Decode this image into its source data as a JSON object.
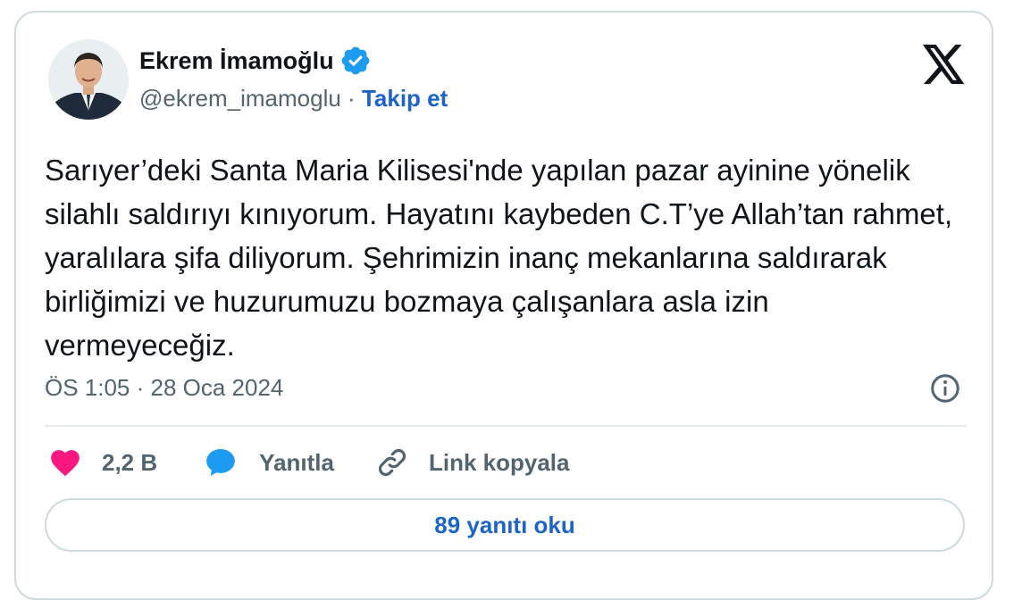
{
  "author": {
    "name": "Ekrem İmamoğlu",
    "handle": "@ekrem_imamoglu",
    "separator": "·",
    "follow_label": "Takip et",
    "verified": true
  },
  "tweet": {
    "text": "Sarıyer’deki Santa Maria Kilisesi'nde yapılan pazar ayinine yönelik silahlı saldırıyı kınıyorum. Hayatını kaybeden C.T’ye Allah’tan rahmet, yaralılara şifa diliyorum. Şehrimizin inanç mekanlarına saldırarak birliğimizi ve huzurumuzu bozmaya çalışanlara asla izin vermeyeceğiz.",
    "timestamp": "ÖS 1:05 · 28 Oca 2024"
  },
  "actions": {
    "like_count": "2,2 B",
    "reply_label": "Yanıtla",
    "copy_link_label": "Link kopyala"
  },
  "read_replies_label": "89 yanıtı oku",
  "icons": {
    "avatar": "avatar",
    "verified": "verified-badge-icon",
    "logo": "x-logo-icon",
    "info": "info-icon",
    "like": "heart-icon",
    "reply": "speech-bubble-icon",
    "copy": "link-icon"
  },
  "colors": {
    "accent": "#1d64c9",
    "verified": "#1d9bf0",
    "like": "#f91880",
    "muted": "#536471",
    "border": "#cfd9de"
  }
}
